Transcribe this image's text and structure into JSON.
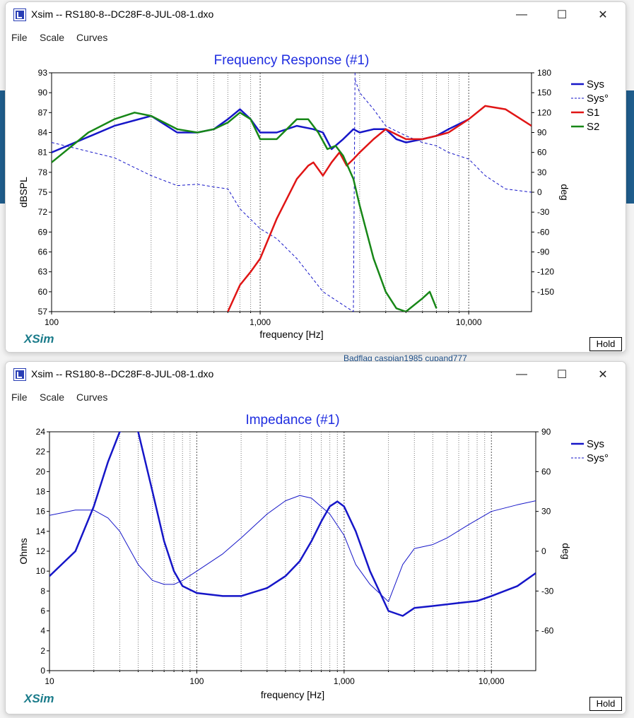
{
  "background": {
    "partial_text": "Badflag  caspian1985  cupand777"
  },
  "windows": [
    {
      "id": "win1",
      "title": "Xsim -- RS180-8--DC28F-8-JUL-08-1.dxo",
      "menu": [
        "File",
        "Scale",
        "Curves"
      ],
      "controls": {
        "minimize": "—",
        "maximize": "☐",
        "close": "✕"
      },
      "logo": "XSim",
      "hold_label": "Hold"
    },
    {
      "id": "win2",
      "title": "Xsim -- RS180-8--DC28F-8-JUL-08-1.dxo",
      "menu": [
        "File",
        "Scale",
        "Curves"
      ],
      "controls": {
        "minimize": "—",
        "maximize": "☐",
        "close": "✕"
      },
      "logo": "XSim",
      "hold_label": "Hold"
    }
  ],
  "chart_data": [
    {
      "type": "line",
      "title": "Frequency Response (#1)",
      "xlabel": "frequency [Hz]",
      "ylabel": "dBSPL",
      "y2label": "deg",
      "xscale": "log",
      "xlim": [
        100,
        20000
      ],
      "ylim": [
        57,
        93
      ],
      "y2lim": [
        -180,
        180
      ],
      "x_tick_labels": [
        "100",
        "1,000",
        "10,000"
      ],
      "y_ticks": [
        57,
        60,
        63,
        66,
        69,
        72,
        75,
        78,
        81,
        84,
        87,
        90,
        93
      ],
      "y2_ticks": [
        -150,
        -120,
        -90,
        -60,
        -30,
        0,
        30,
        60,
        90,
        120,
        150,
        180
      ],
      "grid": true,
      "legend_position": "right",
      "colors": {
        "Sys": "#1616c8",
        "S1": "#e01515",
        "S2": "#178717"
      },
      "series": [
        {
          "name": "Sys",
          "axis": "left",
          "style": "solid",
          "x": [
            100,
            200,
            300,
            400,
            500,
            600,
            700,
            800,
            900,
            1000,
            1200,
            1500,
            1800,
            2000,
            2200,
            2500,
            2800,
            3000,
            3500,
            4000,
            4500,
            5000,
            6000,
            7000,
            8000,
            10000
          ],
          "y": [
            81,
            85,
            86.5,
            84,
            84,
            84.5,
            86,
            87.5,
            86,
            84,
            84,
            85,
            84.5,
            84,
            81.5,
            83,
            84.5,
            84,
            84.5,
            84.5,
            83,
            82.5,
            83,
            83.5,
            84.5,
            86
          ]
        },
        {
          "name": "Sys°",
          "axis": "right",
          "style": "dashed",
          "x": [
            100,
            200,
            300,
            400,
            500,
            600,
            700,
            800,
            1000,
            1200,
            1500,
            2000,
            2500,
            2800,
            2850,
            3000,
            3500,
            4000,
            5000,
            6000,
            7000,
            8000,
            10000,
            12000,
            15000,
            20000
          ],
          "y": [
            75,
            52,
            25,
            10,
            12,
            8,
            5,
            -25,
            -55,
            -70,
            -100,
            -150,
            -170,
            -180,
            170,
            150,
            125,
            100,
            85,
            75,
            70,
            60,
            50,
            25,
            5,
            0
          ]
        },
        {
          "name": "S1",
          "axis": "left",
          "style": "solid",
          "x": [
            700,
            800,
            900,
            1000,
            1200,
            1500,
            1700,
            1800,
            2000,
            2200,
            2400,
            2600,
            2800,
            3000,
            3500,
            4000,
            5000,
            6000,
            7000,
            8000,
            10000,
            12000,
            15000,
            20000
          ],
          "y": [
            57,
            61,
            63,
            65,
            71,
            77,
            79,
            79.5,
            77.5,
            79.5,
            81,
            79,
            80,
            81,
            83,
            84.5,
            83,
            83,
            83.5,
            84,
            86,
            88,
            87.5,
            85
          ]
        },
        {
          "name": "S2",
          "axis": "left",
          "style": "solid",
          "x": [
            100,
            150,
            200,
            250,
            300,
            400,
            500,
            600,
            700,
            800,
            900,
            1000,
            1200,
            1500,
            1700,
            1900,
            2100,
            2300,
            2500,
            2800,
            3000,
            3500,
            4000,
            4500,
            5000,
            6000,
            6500,
            7000
          ],
          "y": [
            79.5,
            84,
            86,
            87,
            86.5,
            84.5,
            84,
            84.5,
            85.5,
            87,
            86,
            83,
            83,
            86,
            86,
            84,
            81.5,
            82,
            80.5,
            77,
            73,
            65,
            60,
            57.5,
            57,
            59,
            60,
            57.5
          ]
        }
      ]
    },
    {
      "type": "line",
      "title": "Impedance (#1)",
      "xlabel": "frequency [Hz]",
      "ylabel": "Ohms",
      "y2label": "deg",
      "xscale": "log",
      "xlim": [
        10,
        20000
      ],
      "ylim": [
        0,
        24
      ],
      "y2lim": [
        -90,
        90
      ],
      "x_tick_labels": [
        "10",
        "100",
        "1,000",
        "10,000"
      ],
      "y_ticks": [
        0,
        2,
        4,
        6,
        8,
        10,
        12,
        14,
        16,
        18,
        20,
        22,
        24
      ],
      "y2_ticks": [
        -60,
        -30,
        0,
        30,
        60,
        90
      ],
      "grid": true,
      "legend_position": "right",
      "colors": {
        "Sys": "#1616c8"
      },
      "series": [
        {
          "name": "Sys",
          "axis": "left",
          "style": "thick",
          "x": [
            10,
            15,
            20,
            25,
            30,
            35,
            40,
            50,
            60,
            70,
            80,
            100,
            150,
            200,
            300,
            400,
            500,
            600,
            700,
            800,
            900,
            1000,
            1200,
            1500,
            2000,
            2500,
            3000,
            4000,
            6000,
            8000,
            10000,
            15000,
            20000
          ],
          "y": [
            9.5,
            12,
            16.5,
            21,
            24,
            24.5,
            24,
            18,
            13,
            10,
            8.5,
            7.8,
            7.5,
            7.5,
            8.3,
            9.5,
            11,
            13,
            15,
            16.5,
            17,
            16.5,
            14,
            10,
            6,
            5.5,
            6.3,
            6.5,
            6.8,
            7,
            7.5,
            8.5,
            9.8
          ]
        },
        {
          "name": "Sys°",
          "axis": "right",
          "style": "thin",
          "x": [
            10,
            15,
            20,
            25,
            30,
            40,
            50,
            60,
            70,
            80,
            100,
            150,
            200,
            300,
            400,
            500,
            600,
            800,
            1000,
            1200,
            1500,
            2000,
            2500,
            3000,
            4000,
            5000,
            7000,
            10000,
            15000,
            20000
          ],
          "y": [
            27,
            31,
            31,
            25,
            15,
            -10,
            -22,
            -25,
            -25,
            -22,
            -15,
            -2,
            10,
            28,
            38,
            42,
            40,
            28,
            12,
            -10,
            -25,
            -38,
            -10,
            2,
            5,
            10,
            20,
            30,
            35,
            38
          ]
        }
      ]
    }
  ]
}
